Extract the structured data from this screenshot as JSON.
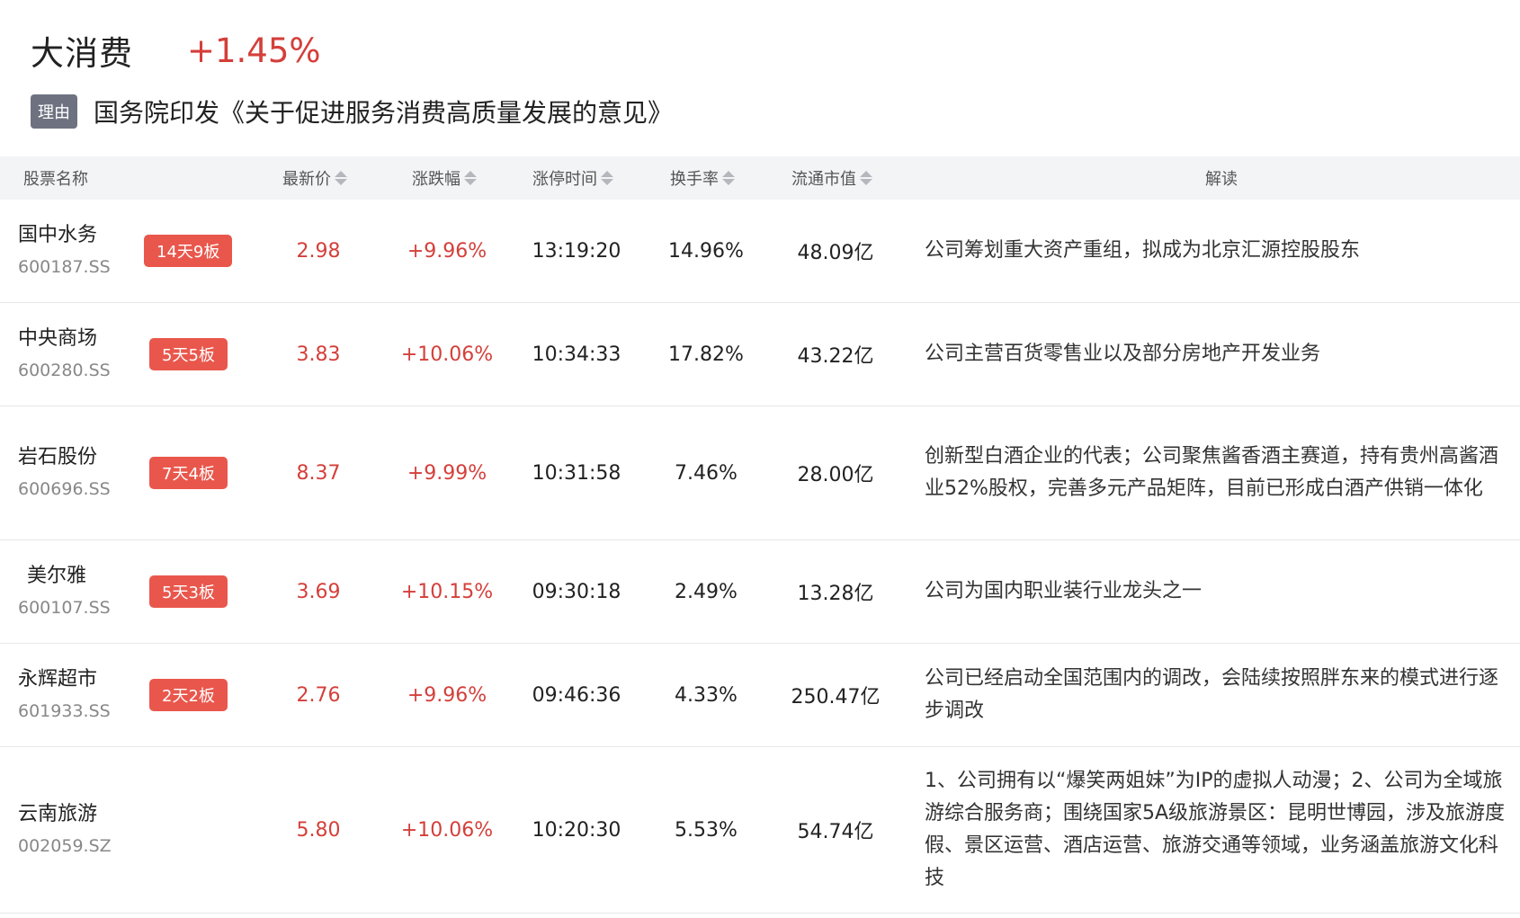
{
  "header": {
    "title": "大消费",
    "change": "+1.45%",
    "reason_tag": "理由",
    "reason_text": "国务院印发《关于促进服务消费高质量发展的意见》"
  },
  "columns": {
    "name": "股票名称",
    "price": "最新价",
    "change": "涨跌幅",
    "limit_time": "涨停时间",
    "turnover": "换手率",
    "market_cap": "流通市值",
    "desc": "解读"
  },
  "rows": [
    {
      "name": "国中水务",
      "code": "600187.SS",
      "badge": "14天9板",
      "price": "2.98",
      "change": "+9.96%",
      "limit_time": "13:19:20",
      "turnover": "14.96%",
      "market_cap": "48.09亿",
      "desc": "公司筹划重大资产重组，拟成为北京汇源控股股东"
    },
    {
      "name": "中央商场",
      "code": "600280.SS",
      "badge": "5天5板",
      "price": "3.83",
      "change": "+10.06%",
      "limit_time": "10:34:33",
      "turnover": "17.82%",
      "market_cap": "43.22亿",
      "desc": "公司主营百货零售业以及部分房地产开发业务"
    },
    {
      "name": "岩石股份",
      "code": "600696.SS",
      "badge": "7天4板",
      "price": "8.37",
      "change": "+9.99%",
      "limit_time": "10:31:58",
      "turnover": "7.46%",
      "market_cap": "28.00亿",
      "desc": "创新型白酒企业的代表；公司聚焦酱香酒主赛道，持有贵州高酱酒业52%股权，完善多元产品矩阵，目前已形成白酒产供销一体化"
    },
    {
      "name": "美尔雅",
      "code": "600107.SS",
      "badge": "5天3板",
      "price": "3.69",
      "change": "+10.15%",
      "limit_time": "09:30:18",
      "turnover": "2.49%",
      "market_cap": "13.28亿",
      "desc": "公司为国内职业装行业龙头之一"
    },
    {
      "name": "永辉超市",
      "code": "601933.SS",
      "badge": "2天2板",
      "price": "2.76",
      "change": "+9.96%",
      "limit_time": "09:46:36",
      "turnover": "4.33%",
      "market_cap": "250.47亿",
      "desc": "公司已经启动全国范围内的调改，会陆续按照胖东来的模式进行逐步调改"
    },
    {
      "name": "云南旅游",
      "code": "002059.SZ",
      "badge": "",
      "price": "5.80",
      "change": "+10.06%",
      "limit_time": "10:20:30",
      "turnover": "5.53%",
      "market_cap": "54.74亿",
      "desc": "1、公司拥有以“爆笑两姐妹”为IP的虚拟人动漫；2、公司为全域旅游综合服务商；围绕国家5A级旅游景区：昆明世博园，涉及旅游度假、景区运营、酒店运营、旅游交通等领域，业务涵盖旅游文化科技"
    }
  ],
  "colors": {
    "up": "#d43f3a",
    "badge": "#e9574c",
    "reason_tag": "#6e7280",
    "header_bg": "#f3f4f6"
  }
}
